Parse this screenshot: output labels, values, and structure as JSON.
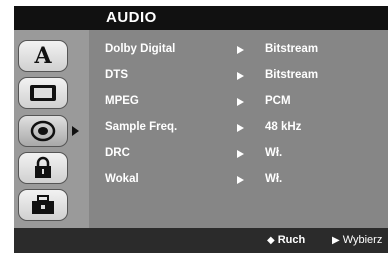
{
  "menu": {
    "title": "AUDIO",
    "tabs": [
      {
        "name": "language",
        "icon": "letter-a-icon"
      },
      {
        "name": "display",
        "icon": "monitor-icon"
      },
      {
        "name": "audio",
        "icon": "speaker-icon",
        "selected": true
      },
      {
        "name": "lock",
        "icon": "padlock-icon"
      },
      {
        "name": "others",
        "icon": "briefcase-icon"
      }
    ],
    "rows": [
      {
        "label": "Dolby Digital",
        "value": "Bitstream"
      },
      {
        "label": "DTS",
        "value": "Bitstream"
      },
      {
        "label": "MPEG",
        "value": "PCM"
      },
      {
        "label": "Sample Freq.",
        "value": "48 kHz"
      },
      {
        "label": "DRC",
        "value": "Wł."
      },
      {
        "label": "Wokal",
        "value": "Wł."
      }
    ]
  },
  "footer": {
    "move_glyph": "◆",
    "move_label": "Ruch",
    "select_glyph": "▶",
    "select_label": "Wybierz"
  },
  "colors": {
    "panel": "#868686",
    "title_bar": "#111111",
    "status_bar": "#2b2b2b",
    "text": "#ffffff"
  }
}
